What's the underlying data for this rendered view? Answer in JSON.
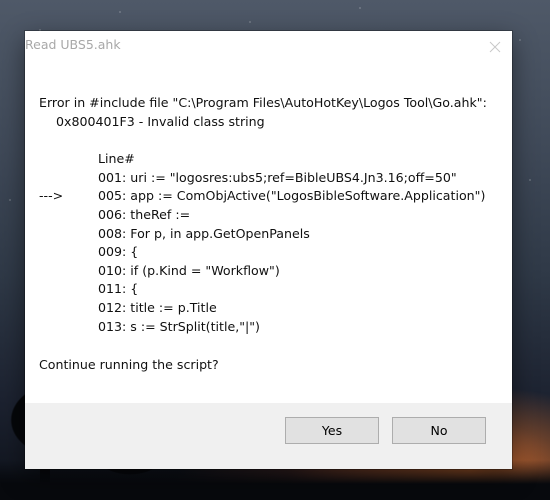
{
  "window": {
    "title": "Read UBS5.ahk",
    "close_icon": "close-icon"
  },
  "message": {
    "error_line": "Error in #include file \"C:\\Program Files\\AutoHotKey\\Logos Tool\\Go.ahk\":",
    "error_code_line": "0x800401F3 - Invalid class string",
    "code_header": "Line#",
    "code_lines": [
      {
        "marker": "",
        "text": "001: uri := \"logosres:ubs5;ref=BibleUBS4.Jn3.16;off=50\""
      },
      {
        "marker": "--->",
        "text": "005: app := ComObjActive(\"LogosBibleSoftware.Application\")"
      },
      {
        "marker": "",
        "text": "006: theRef :="
      },
      {
        "marker": "",
        "text": "008: For p, in app.GetOpenPanels"
      },
      {
        "marker": "",
        "text": "009: {"
      },
      {
        "marker": "",
        "text": "010: if (p.Kind = \"Workflow\")"
      },
      {
        "marker": "",
        "text": "011: {"
      },
      {
        "marker": "",
        "text": "012: title := p.Title"
      },
      {
        "marker": "",
        "text": "013: s := StrSplit(title,\"|\")"
      }
    ],
    "question": "Continue running the script?"
  },
  "buttons": {
    "yes_label": "Yes",
    "no_label": "No"
  }
}
